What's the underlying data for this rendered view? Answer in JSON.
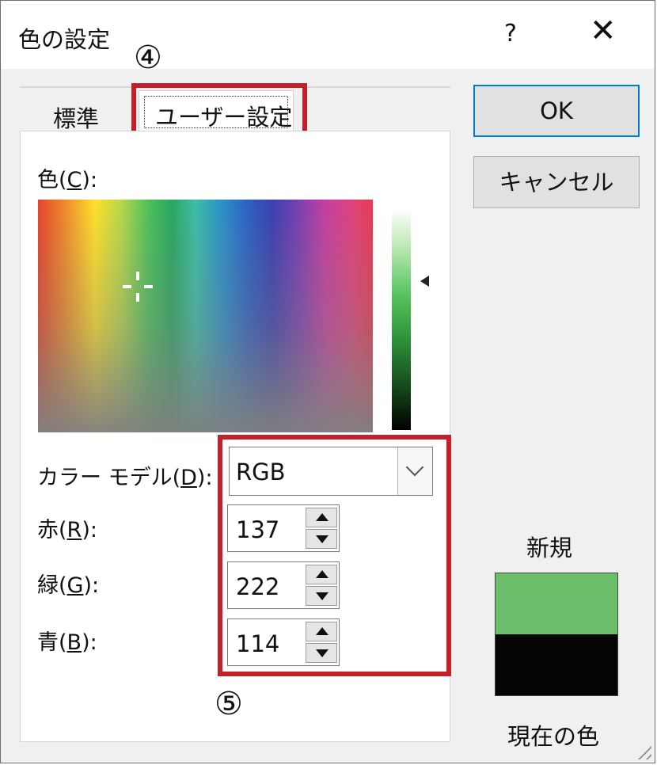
{
  "dialog": {
    "title": "色の設定",
    "help_label": "?",
    "close_label": "✕"
  },
  "tabs": [
    {
      "label": "標準"
    },
    {
      "label": "ユーザー設定"
    }
  ],
  "custom": {
    "color_label_prefix": "色(",
    "color_label_key": "C",
    "color_label_suffix": "):",
    "model_label_prefix": "カラー モデル(",
    "model_label_key": "D",
    "model_label_suffix": "):",
    "model_value": "RGB",
    "red_label_prefix": "赤(",
    "red_label_key": "R",
    "red_label_suffix": "):",
    "red_value": "137",
    "green_label_prefix": "緑(",
    "green_label_key": "G",
    "green_label_suffix": "):",
    "green_value": "222",
    "blue_label_prefix": "青(",
    "blue_label_key": "B",
    "blue_label_suffix": "):",
    "blue_value": "114"
  },
  "buttons": {
    "ok": "OK",
    "cancel": "キャンセル"
  },
  "preview": {
    "new_label": "新規",
    "current_label": "現在の色",
    "new_color": "#6cbd6a",
    "current_color": "#050505"
  },
  "annotations": {
    "step4": "④",
    "step5": "⑤",
    "highlight_color": "#c4202a"
  }
}
